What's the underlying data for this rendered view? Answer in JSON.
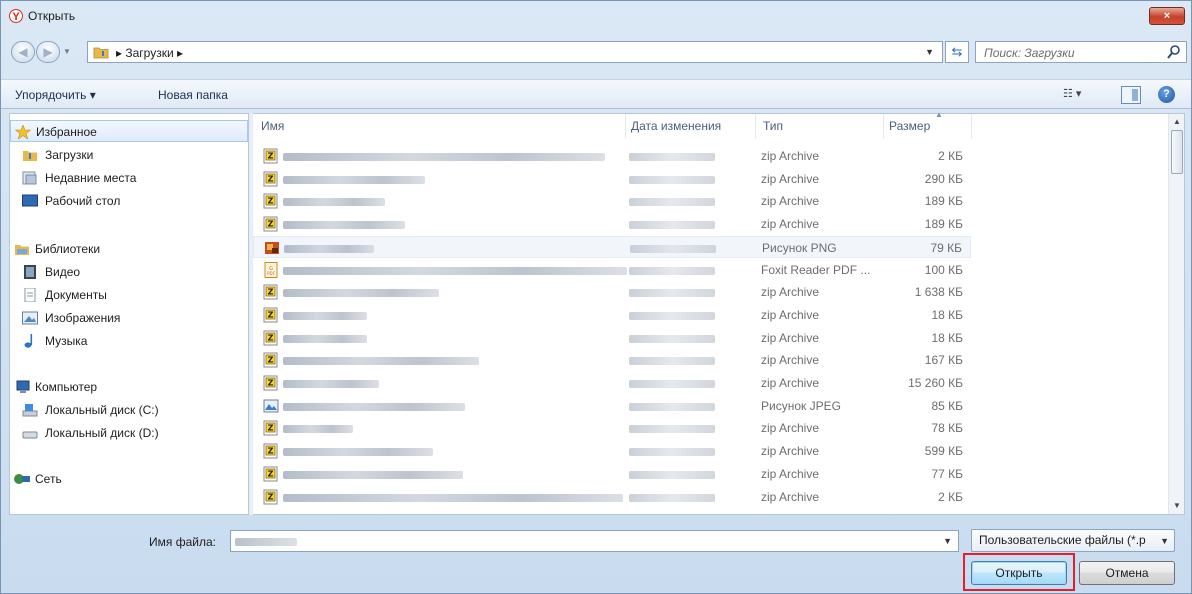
{
  "window": {
    "title": "Открыть",
    "app_icon_letter": "Y",
    "close_symbol": "×"
  },
  "address": {
    "crumbs": "▸  Загрузки  ▸",
    "search_placeholder": "Поиск: Загрузки"
  },
  "toolbar": {
    "organize": "Упорядочить ▾",
    "new_folder": "Новая папка"
  },
  "nav": {
    "favorites": "Избранное",
    "downloads": "Загрузки",
    "recent": "Недавние места",
    "desktop": "Рабочий стол",
    "libraries": "Библиотеки",
    "video": "Видео",
    "documents": "Документы",
    "images": "Изображения",
    "music": "Музыка",
    "computer": "Компьютер",
    "disk_c": "Локальный диск (C:)",
    "disk_d": "Локальный диск (D:)",
    "network": "Сеть"
  },
  "columns": {
    "name": "Имя",
    "date": "Дата изменения",
    "type": "Тип",
    "size": "Размер"
  },
  "files": [
    {
      "icon": "zip",
      "type": "zip Archive",
      "size": "2 КБ"
    },
    {
      "icon": "zip",
      "type": "zip Archive",
      "size": "290 КБ"
    },
    {
      "icon": "zip",
      "type": "zip Archive",
      "size": "189 КБ"
    },
    {
      "icon": "zip",
      "type": "zip Archive",
      "size": "189 КБ"
    },
    {
      "icon": "png",
      "type": "Рисунок PNG",
      "size": "79 КБ"
    },
    {
      "icon": "pdf",
      "type": "Foxit Reader PDF ...",
      "size": "100 КБ"
    },
    {
      "icon": "zip",
      "type": "zip Archive",
      "size": "1 638 КБ"
    },
    {
      "icon": "zip",
      "type": "zip Archive",
      "size": "18 КБ"
    },
    {
      "icon": "zip",
      "type": "zip Archive",
      "size": "18 КБ"
    },
    {
      "icon": "zip",
      "type": "zip Archive",
      "size": "167 КБ"
    },
    {
      "icon": "zip",
      "type": "zip Archive",
      "size": "15 260 КБ"
    },
    {
      "icon": "jpeg",
      "type": "Рисунок JPEG",
      "size": "85 КБ"
    },
    {
      "icon": "zip",
      "type": "zip Archive",
      "size": "78 КБ"
    },
    {
      "icon": "zip",
      "type": "zip Archive",
      "size": "599 КБ"
    },
    {
      "icon": "zip",
      "type": "zip Archive",
      "size": "77 КБ"
    },
    {
      "icon": "zip",
      "type": "zip Archive",
      "size": "2 КБ"
    }
  ],
  "bottom": {
    "filename_label": "Имя файла:",
    "filter": "Пользовательские файлы (*.p",
    "open": "Открыть",
    "cancel": "Отмена"
  },
  "colors": {
    "highlight_outline": "#e0202a",
    "accent": "#3c7fb1"
  }
}
